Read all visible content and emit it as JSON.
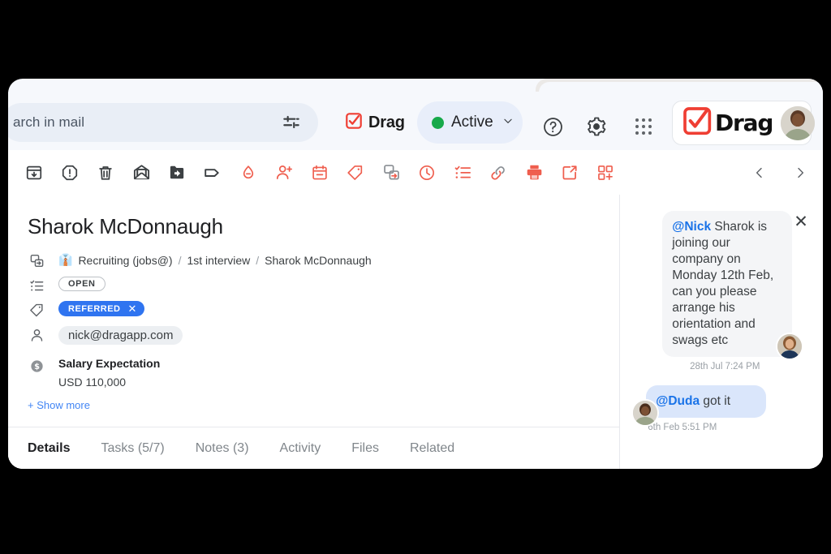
{
  "app": {
    "brand_name": "Drag",
    "accent_red": "#ef5350",
    "accent_blue": "#2f74f0",
    "status_green": "#17a94a"
  },
  "topbar": {
    "search_value": "arch in mail",
    "search_placeholder": "Search in mail",
    "tune_icon": "tune-icon",
    "drag_badge_label": "Drag",
    "status_label": "Active",
    "status_chevron": "⌄",
    "help_icon": "help-icon",
    "settings_icon": "gear-icon",
    "apps_icon": "apps-grid-icon",
    "account_brand": "Drag",
    "account_avatar": "user-avatar"
  },
  "toolbar": {
    "icons": [
      {
        "name": "archive-icon",
        "color": "dark"
      },
      {
        "name": "report-spam-icon",
        "color": "dark"
      },
      {
        "name": "delete-icon",
        "color": "dark"
      },
      {
        "name": "mark-unread-icon",
        "color": "dark"
      },
      {
        "name": "move-to-folder-icon",
        "color": "dark"
      },
      {
        "name": "label-icon",
        "color": "dark"
      },
      {
        "name": "drop-remove-icon",
        "color": "red"
      },
      {
        "name": "add-person-icon",
        "color": "red"
      },
      {
        "name": "calendar-icon",
        "color": "red"
      },
      {
        "name": "tag-icon",
        "color": "red"
      },
      {
        "name": "move-to-board-icon",
        "color": "red"
      },
      {
        "name": "snooze-clock-icon",
        "color": "red"
      },
      {
        "name": "checklist-icon",
        "color": "red"
      },
      {
        "name": "link-icon",
        "color": "red"
      },
      {
        "name": "print-icon",
        "color": "red"
      },
      {
        "name": "open-in-new-icon",
        "color": "red"
      },
      {
        "name": "add-widget-icon",
        "color": "red"
      }
    ],
    "prev_label": "‹",
    "next_label": "›"
  },
  "record": {
    "title": "Sharok McDonnaugh",
    "breadcrumb": {
      "board_emoji": "👔",
      "board": "Recruiting (jobs@)",
      "sep": "/",
      "stage": "1st interview",
      "card": "Sharok McDonnaugh"
    },
    "status_badge": "OPEN",
    "tag_badge": "REFERRED",
    "tag_remove": "✕",
    "contact_email": "nick@dragapp.com",
    "salary_label": "Salary Expectation",
    "salary_value": "USD 110,000",
    "show_more": "+ Show more"
  },
  "tabs": [
    {
      "label": "Details",
      "active": true
    },
    {
      "label": "Tasks (5/7)",
      "active": false
    },
    {
      "label": "Notes (3)",
      "active": false
    },
    {
      "label": "Activity",
      "active": false
    },
    {
      "label": "Files",
      "active": false
    },
    {
      "label": "Related",
      "active": false
    }
  ],
  "chat": {
    "close_label": "✕",
    "messages": [
      {
        "mention": "@Nick",
        "text": " Sharok is joining our company on Monday 12th Feb, can you please arrange his orientation and swags etc",
        "time": "28th Jul 7:24 PM",
        "style": "grey",
        "avatar": "woman-avatar"
      },
      {
        "mention": "@Duda",
        "text": " got it",
        "time": "6th Feb 5:51 PM",
        "style": "blue",
        "avatar": "man-avatar"
      }
    ]
  }
}
